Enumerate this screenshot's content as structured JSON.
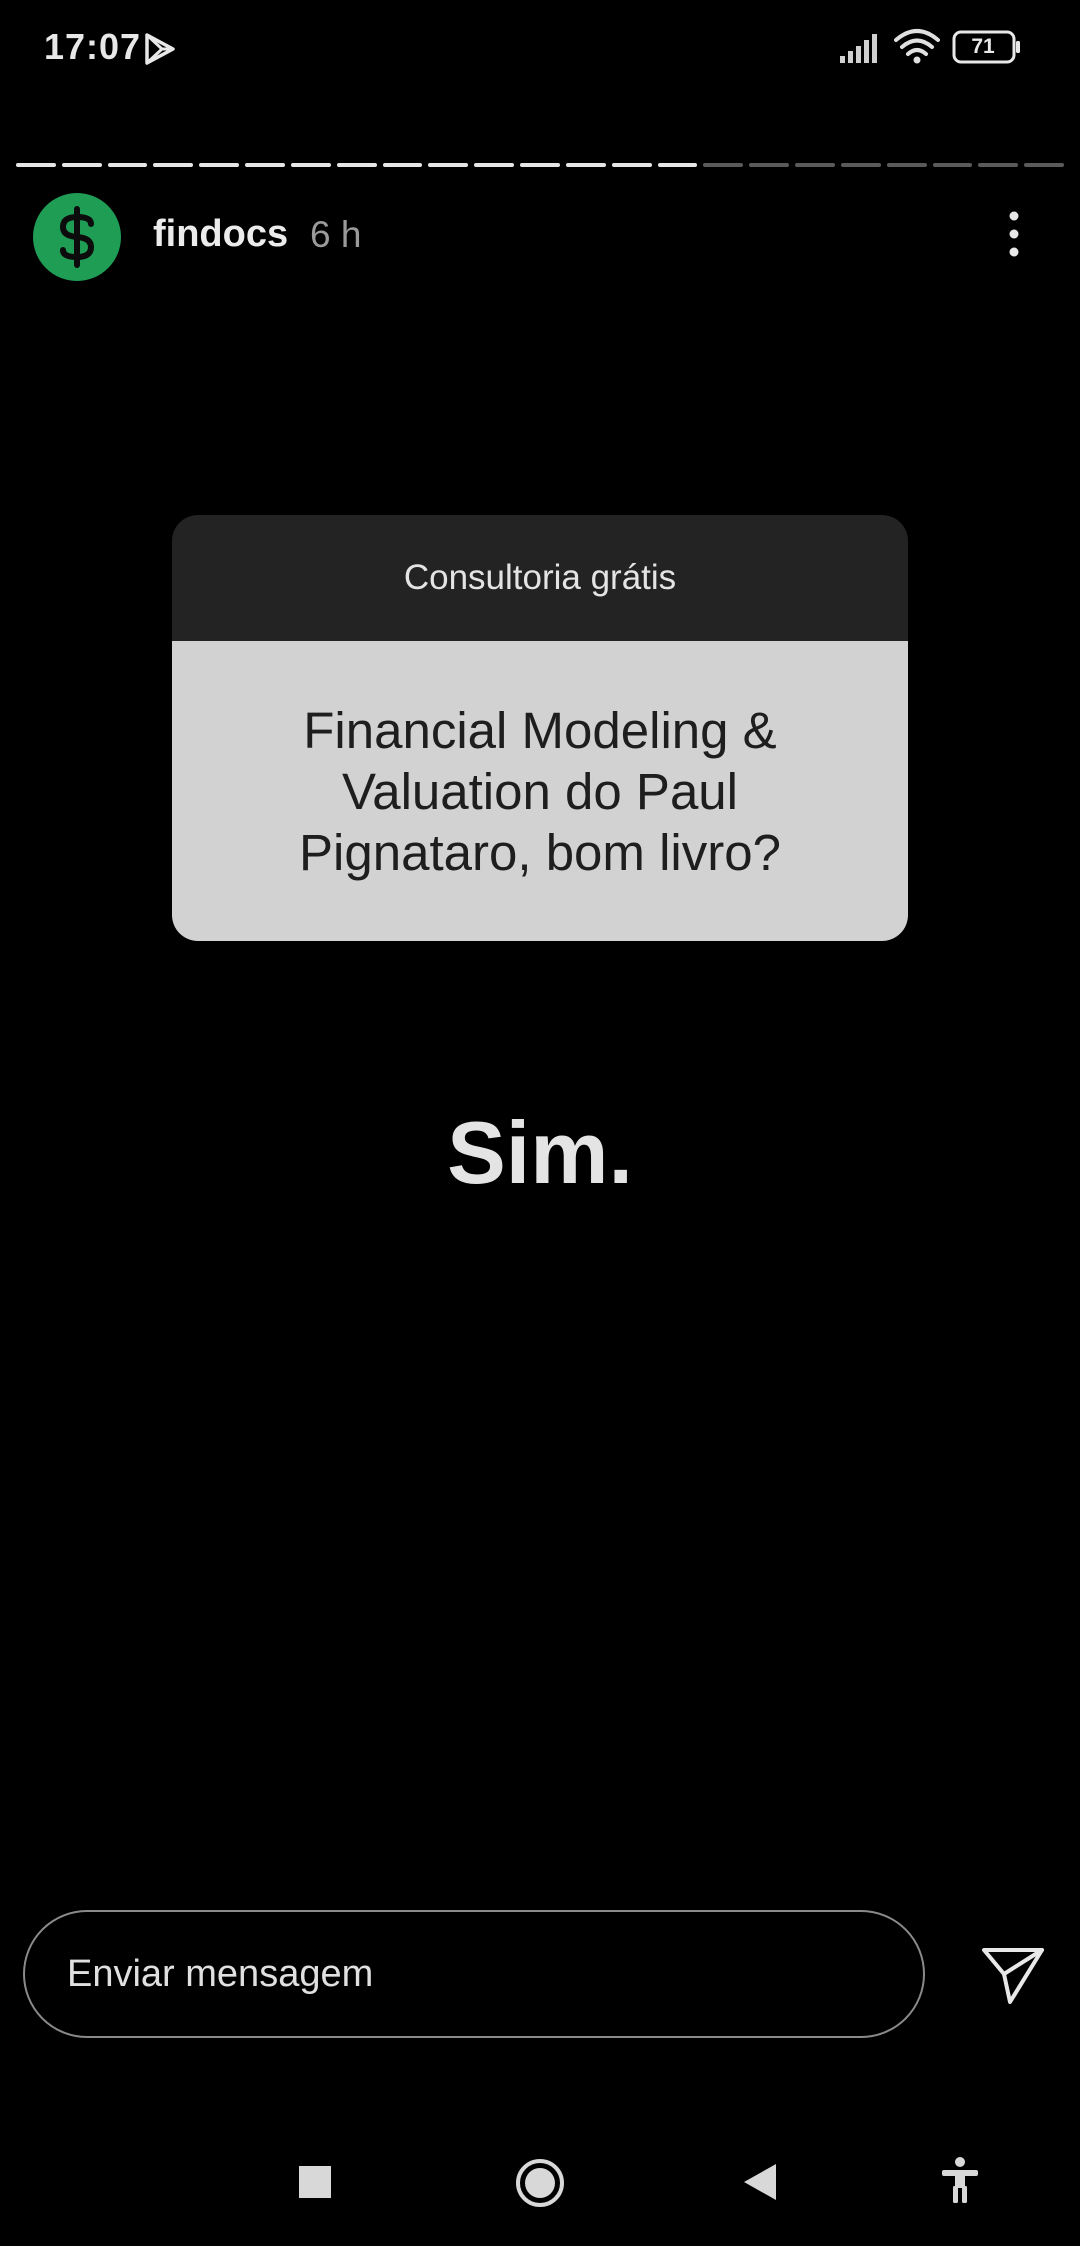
{
  "status_bar": {
    "time": "17:07",
    "battery": "71"
  },
  "story": {
    "progress": {
      "segments": 23,
      "viewed": 15
    },
    "username": "findocs",
    "time_ago": "6 h",
    "question_title": "Consultoria grátis",
    "question_text": "Financial Modeling & Valuation do Paul Pignataro, bom livro?",
    "answer": "Sim."
  },
  "message_bar": {
    "placeholder": "Enviar mensagem"
  },
  "colors": {
    "background": "#000000",
    "avatar": "#1f9d55",
    "sticker_header": "#232323",
    "sticker_body": "#d2d2d2"
  },
  "icons": {
    "status": [
      "play-store-icon",
      "signal-icon",
      "wifi-icon",
      "battery-icon"
    ],
    "header": [
      "dollar-icon",
      "more-vertical-icon"
    ],
    "message": [
      "send-icon"
    ],
    "navigation": [
      "recents-icon",
      "home-icon",
      "back-icon",
      "accessibility-icon"
    ]
  }
}
